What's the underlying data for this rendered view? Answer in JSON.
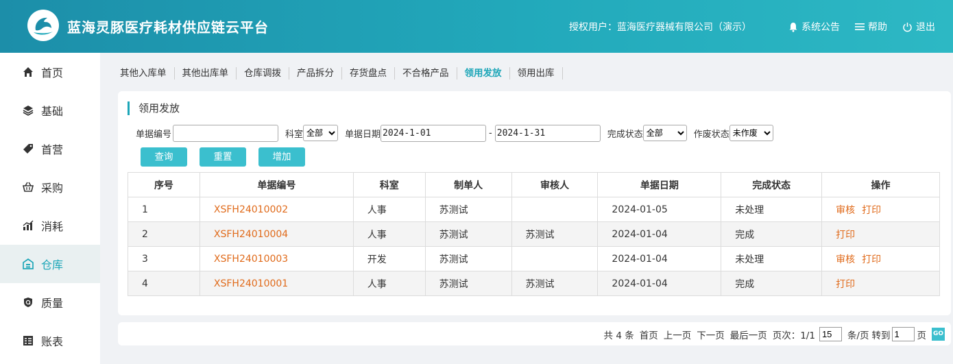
{
  "header": {
    "title": "蓝海灵豚医疗耗材供应链云平台",
    "user": "授权用户：蓝海医疗器械有限公司（演示）",
    "notice": "系统公告",
    "help": "帮助",
    "logout": "退出"
  },
  "sidebar": {
    "items": [
      {
        "label": "首页",
        "icon": "home-icon"
      },
      {
        "label": "基础",
        "icon": "layers-icon"
      },
      {
        "label": "首营",
        "icon": "tag-icon"
      },
      {
        "label": "采购",
        "icon": "basket-icon"
      },
      {
        "label": "消耗",
        "icon": "chart-icon"
      },
      {
        "label": "仓库",
        "icon": "warehouse-icon",
        "active": true
      },
      {
        "label": "质量",
        "icon": "quality-icon"
      },
      {
        "label": "账表",
        "icon": "ledger-icon"
      }
    ]
  },
  "tabs": [
    "其他入库单",
    "其他出库单",
    "仓库调拨",
    "产品拆分",
    "存货盘点",
    "不合格产品",
    "领用发放",
    "领用出库"
  ],
  "active_tab": "领用发放",
  "panel": {
    "title": "领用发放"
  },
  "filters": {
    "doc_no_label": "单据编号",
    "doc_no_value": "",
    "dept_label": "科室",
    "dept_value": "全部",
    "date_label": "单据日期",
    "date_from": "2024-1-01",
    "date_sep": "-",
    "date_to": "2024-1-31",
    "status_label": "完成状态",
    "status_value": "全部",
    "void_label": "作废状态",
    "void_value": "未作废"
  },
  "buttons": {
    "query": "查询",
    "reset": "重置",
    "add": "增加"
  },
  "table": {
    "columns": [
      "序号",
      "单据编号",
      "科室",
      "制单人",
      "审核人",
      "单据日期",
      "完成状态",
      "操作"
    ],
    "rows": [
      {
        "no": "1",
        "code": "XSFH24010002",
        "dept": "人事",
        "maker": "苏测试",
        "auditor": "",
        "date": "2024-01-05",
        "status": "未处理",
        "ops": [
          "审核",
          "打印"
        ]
      },
      {
        "no": "2",
        "code": "XSFH24010004",
        "dept": "人事",
        "maker": "苏测试",
        "auditor": "苏测试",
        "date": "2024-01-04",
        "status": "完成",
        "ops": [
          "打印"
        ]
      },
      {
        "no": "3",
        "code": "XSFH24010003",
        "dept": "开发",
        "maker": "苏测试",
        "auditor": "",
        "date": "2024-01-04",
        "status": "未处理",
        "ops": [
          "审核",
          "打印"
        ]
      },
      {
        "no": "4",
        "code": "XSFH24010001",
        "dept": "人事",
        "maker": "苏测试",
        "auditor": "苏测试",
        "date": "2024-01-04",
        "status": "完成",
        "ops": [
          "打印"
        ]
      }
    ]
  },
  "pager": {
    "total": "共 4 条",
    "first": "首页",
    "prev": "上一页",
    "next": "下一页",
    "last": "最后一页",
    "page_info": "页次：1/1",
    "page_size": "15",
    "per_page": "条/页",
    "goto": "转到",
    "goto_value": "1",
    "page_unit": "页",
    "go": "GO"
  },
  "colors": {
    "accent": "#1da6b8",
    "button": "#3bbfce",
    "link": "#e06a1a"
  }
}
